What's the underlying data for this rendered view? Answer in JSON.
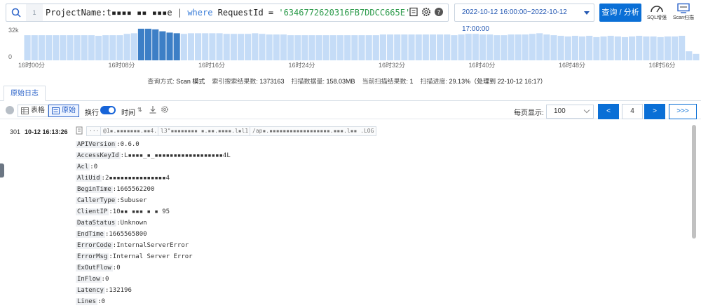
{
  "query": {
    "line_number": "1",
    "parts": [
      {
        "text": "ProjectName:t",
        "cls": ""
      },
      {
        "text": "▪▪▪▪ ▪▪ ▪▪▪e",
        "cls": ""
      },
      {
        "text": " | ",
        "cls": "pipe"
      },
      {
        "text": "where",
        "cls": "kw"
      },
      {
        "text": " RequestId = ",
        "cls": ""
      },
      {
        "text": "'6346772620316FB7DDCC665E'",
        "cls": "str"
      }
    ]
  },
  "time_range": "2022-10-12 16:00:00~2022-10-12 17:00:00",
  "search_button": "查询 / 分析",
  "sql_boost_label": "SQL增强",
  "scan_label": "Scan扫描",
  "histogram": {
    "y_max_label": "32k",
    "y_min_label": "0",
    "x_labels": [
      "16时00分",
      "16时08分",
      "16时16分",
      "16时24分",
      "16时32分",
      "16时40分",
      "16时48分",
      "16时56分"
    ],
    "bars": [
      0.78,
      0.78,
      0.78,
      0.78,
      0.78,
      0.78,
      0.78,
      0.78,
      0.78,
      0.78,
      0.76,
      0.78,
      0.78,
      0.78,
      0.82,
      0.84,
      0.98,
      0.98,
      0.96,
      0.9,
      0.86,
      0.84,
      0.82,
      0.84,
      0.84,
      0.84,
      0.84,
      0.84,
      0.82,
      0.82,
      0.82,
      0.82,
      0.84,
      0.82,
      0.8,
      0.8,
      0.8,
      0.78,
      0.78,
      0.78,
      0.78,
      0.78,
      0.78,
      0.78,
      0.78,
      0.78,
      0.78,
      0.78,
      0.78,
      0.78,
      0.8,
      0.8,
      0.8,
      0.8,
      0.8,
      0.8,
      0.8,
      0.8,
      0.8,
      0.8,
      0.78,
      0.8,
      0.82,
      0.82,
      0.8,
      0.8,
      0.78,
      0.78,
      0.8,
      0.8,
      0.8,
      0.82,
      0.84,
      0.8,
      0.78,
      0.76,
      0.74,
      0.76,
      0.74,
      0.76,
      0.72,
      0.74,
      0.76,
      0.74,
      0.72,
      0.74,
      0.76,
      0.74,
      0.74,
      0.72,
      0.74,
      0.74,
      0.76,
      0.28,
      0.2
    ],
    "highlight_start": 16,
    "highlight_end": 21,
    "colors": {
      "bar": "#c5dcf7",
      "highlight": "#3d7fc6"
    }
  },
  "stats": [
    {
      "label": "查询方式:",
      "value": "Scan 模式"
    },
    {
      "label": "索引搜索结果数:",
      "value": "1373163"
    },
    {
      "label": "扫描数据量:",
      "value": "158.03MB"
    },
    {
      "label": "当前扫描结果数:",
      "value": "1"
    },
    {
      "label": "扫描进度:",
      "value": "29.13%（处理到 22-10-12 16:17）"
    }
  ],
  "tab_raw_logs": "原始日志",
  "toolbar": {
    "table_view": "表格",
    "raw_view": "原始",
    "wrap_label": "换行",
    "time_label": "时间",
    "page_size_label": "每页显示:",
    "page_size_value": "100",
    "prev": "<",
    "current_page": "4",
    "next": ">",
    "last": ">>>"
  },
  "log_entry": {
    "index": "301",
    "time": "10-12 16:13:26",
    "chip_more": "···",
    "chip_ip": "@1▪.▪▪▪▪▪▪▪.▪▪4.▪▪J7",
    "chip_source": "l3\"▪▪▪▪▪▪▪▪ ▪.▪▪.▪▪▪▪.l▪l1",
    "chip_path": "/ap▪.▪▪▪▪▪▪▪▪▪▪▪▪▪▪▪▪▪▪.▪▪▪.l▪▪ .LOG",
    "fields": [
      {
        "k": "APIVersion",
        "v": "0.6.0"
      },
      {
        "k": "AccessKeyId",
        "v": "L▪▪▪▪_▪_▪▪▪▪▪▪▪▪▪▪▪▪▪▪▪▪▪▪4L"
      },
      {
        "k": "Acl",
        "v": "0"
      },
      {
        "k": "AliUid",
        "v": "2▪▪▪▪▪▪▪▪▪▪▪▪▪▪▪4"
      },
      {
        "k": "BeginTime",
        "v": "1665562200"
      },
      {
        "k": "CallerType",
        "v": "Subuser"
      },
      {
        "k": "ClientIP",
        "v": "10▪▪ ▪▪▪ ▪ ▪ 95"
      },
      {
        "k": "DataStatus",
        "v": "Unknown"
      },
      {
        "k": "EndTime",
        "v": "1665565800"
      },
      {
        "k": "ErrorCode",
        "v": "InternalServerError"
      },
      {
        "k": "ErrorMsg",
        "v": "Internal Server Error"
      },
      {
        "k": "ExOutFlow",
        "v": "0"
      },
      {
        "k": "InFlow",
        "v": "0"
      },
      {
        "k": "Latency",
        "v": "132196"
      },
      {
        "k": "Lines",
        "v": "0"
      }
    ]
  }
}
